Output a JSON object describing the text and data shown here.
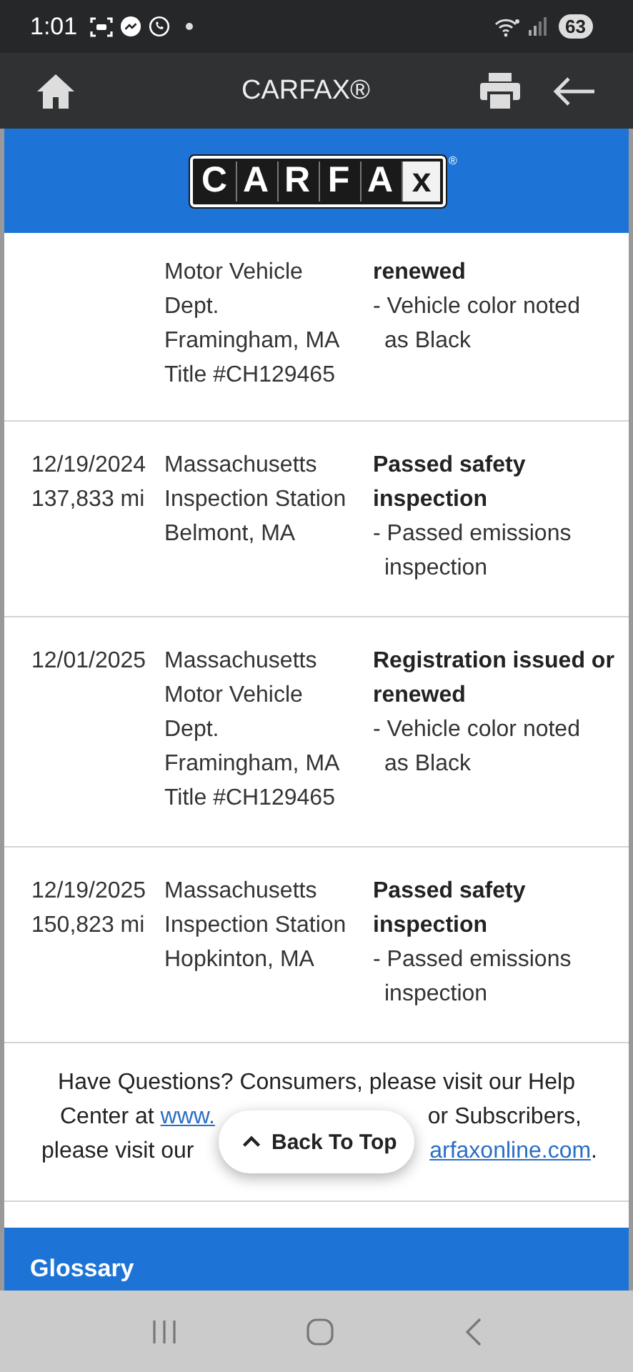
{
  "status_bar": {
    "time": "1:01",
    "battery": "63"
  },
  "app_bar": {
    "title": "CARFAX®"
  },
  "logo": {
    "letters": [
      "C",
      "A",
      "R",
      "F",
      "A",
      "x"
    ],
    "mark": "®"
  },
  "records": [
    {
      "source": [
        "Motor Vehicle",
        "Dept.",
        "Framingham, MA",
        "Title #CH129465"
      ],
      "title": "renewed",
      "notes": [
        "- Vehicle color noted as Black"
      ]
    },
    {
      "date": "12/19/2024",
      "mileage": "137,833 mi",
      "source": [
        "Massachusetts Inspection Station",
        "Belmont, MA"
      ],
      "title": "Passed safety inspection",
      "notes": [
        "- Passed emissions inspection"
      ]
    },
    {
      "date": "12/01/2025",
      "source": [
        "Massachusetts Motor Vehicle Dept.",
        "Framingham, MA",
        "Title #CH129465"
      ],
      "title": "Registration issued or renewed",
      "notes": [
        "- Vehicle color noted as Black"
      ]
    },
    {
      "date": "12/19/2025",
      "mileage": "150,823 mi",
      "source": [
        "Massachusetts Inspection Station",
        "Hopkinton, MA"
      ],
      "title": "Passed safety inspection",
      "notes": [
        "- Passed emissions inspection"
      ]
    }
  ],
  "help": {
    "line_1": "Have Questions? Consumers, please visit our Help",
    "line_2_start": "Center at",
    "line_2_link": "www.",
    "line_2_end": "or Subscribers,",
    "line_3_start": "please visit our",
    "line_3_link": "arfaxonline.com",
    "line_3_end": "."
  },
  "back_to_top": {
    "label": "Back To Top"
  },
  "glossary": {
    "title": "Glossary"
  }
}
